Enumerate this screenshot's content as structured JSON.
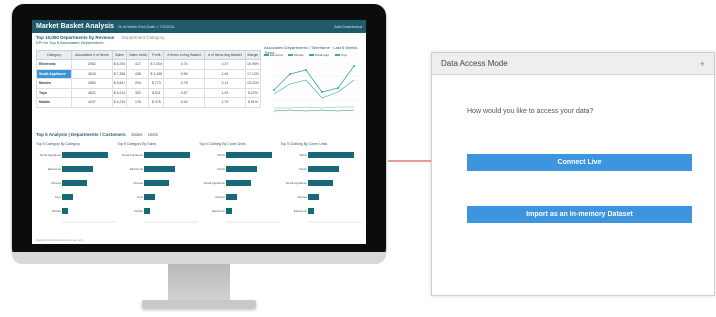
{
  "dashboard": {
    "title": "Market Basket Analysis",
    "title_sub": "% of Week End Date > 7/2/2011",
    "header_right": "Add Dashboard",
    "section_title": "Top 10,000 Departments by Revenue",
    "section_control": "Department Category",
    "kpi_subtitle": "KPI for Top 5 Associated Departments",
    "kpi_table": {
      "headers": [
        "Category",
        "Associated # of Items",
        "Sales",
        "Sales Units",
        "Profit",
        "# Items in Avg Basket",
        "# of Items Avg Basket",
        "Margin"
      ],
      "rows": [
        [
          "Electronic",
          "3962",
          "$ 6,291",
          "417",
          "$ 1,004",
          "0.74",
          "2.27",
          "15.95%"
        ],
        [
          "Small Appliance",
          "3926",
          "$ 7,384",
          "438",
          "$ 1,265",
          "0.96",
          "2.46",
          "17.13%"
        ],
        [
          "Movies",
          "2560",
          "$ 5,847",
          "294",
          "$ 773",
          "0.78",
          "2.11",
          "13.22%"
        ],
        [
          "Toys",
          "4622",
          "$ 6,213",
          "302",
          "$ 511",
          "0.57",
          "1.93",
          "8.22%"
        ],
        [
          "Mobile",
          "4247",
          "$ 4,219",
          "176",
          "$ 376",
          "0.44",
          "1.79",
          "8.91%"
        ]
      ],
      "selected_row": 1
    },
    "line_chart_title": "Associated Departments / Timeframe",
    "line_chart_subtitle": "Last 6 Weeks Trend",
    "line_legend": [
      "Electronic",
      "Movies",
      "Small Appl.",
      "Toys"
    ],
    "line_bottom_legend": [
      "Electronic",
      "Movies",
      "Small Appl.",
      "Toys"
    ],
    "bar_section_title": "Top 5 Analysis | Departments / Customers",
    "bar_options": [
      "Sales",
      "Units"
    ],
    "bar_panels": [
      {
        "title": "Top 5 Category By Category",
        "labels": [
          "Small Appliance",
          "Electronic",
          "Movies",
          "Toys",
          "Mobile"
        ]
      },
      {
        "title": "Top 5 Category By Sales",
        "labels": [
          "Small Appliance",
          "Electronic",
          "Movies",
          "Toys",
          "Mobile"
        ]
      },
      {
        "title": "Top 5 Clothing By Cover Units",
        "labels": [
          "Shirts",
          "Pants",
          "Small Appliance",
          "Movies",
          "Electronic"
        ]
      },
      {
        "title": "Top 5 Clothing By Cover Units",
        "labels": [
          "Shirts",
          "Pants",
          "Small Appliance",
          "Movies",
          "Electronic"
        ]
      }
    ],
    "footer_note": "Data is for illustrative purposes only"
  },
  "dialog": {
    "title": "Data Access Mode",
    "close_icon": "plus-icon",
    "question": "How would you like to access your data?",
    "connect_live_label": "Connect Live",
    "import_label": "Import as an In-memory Dataset"
  },
  "colors": {
    "dashboard_header": "#1f5a6d",
    "bar_color": "#17697a",
    "button_blue": "#3d95e0",
    "arrow_red": "#d23b3b"
  }
}
